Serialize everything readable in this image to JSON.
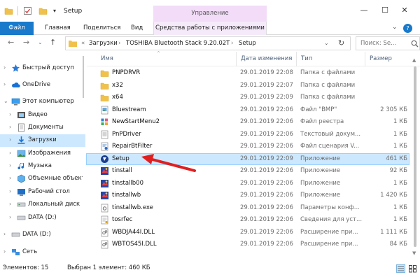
{
  "window": {
    "title": "Setup",
    "manage_tab": "Управление",
    "controls": {
      "minimize": "—",
      "maximize": "☐",
      "close": "✕"
    }
  },
  "ribbon": {
    "tabs": [
      "Файл",
      "Главная",
      "Поделиться",
      "Вид",
      "Средства работы с приложениями"
    ],
    "expand": "⌄",
    "help": "?"
  },
  "address": {
    "prefix": "«",
    "crumbs": [
      "Загрузки",
      "TOSHIBA Bluetooth Stack 9.20.02T",
      "Setup"
    ],
    "separator": "›",
    "search_placeholder": "Поиск: Se..."
  },
  "nav": {
    "back": "←",
    "forward": "→",
    "recent": "⌄",
    "up": "↑",
    "items": [
      {
        "label": "Быстрый доступ",
        "icon": "star-icon"
      },
      {
        "label": "OneDrive",
        "icon": "cloud-icon"
      },
      {
        "label": "Этот компьютер",
        "icon": "computer-icon"
      },
      {
        "label": "Видео",
        "icon": "video-icon"
      },
      {
        "label": "Документы",
        "icon": "documents-icon"
      },
      {
        "label": "Загрузки",
        "icon": "downloads-icon"
      },
      {
        "label": "Изображения",
        "icon": "pictures-icon"
      },
      {
        "label": "Музыка",
        "icon": "music-icon"
      },
      {
        "label": "Объемные объекты",
        "icon": "3d-objects-icon"
      },
      {
        "label": "Рабочий стол",
        "icon": "desktop-icon"
      },
      {
        "label": "Локальный диск",
        "icon": "drive-icon"
      },
      {
        "label": "DATA (D:)",
        "icon": "drive-icon"
      },
      {
        "label": "DATA (D:)",
        "icon": "drive-icon"
      },
      {
        "label": "Сеть",
        "icon": "network-icon"
      }
    ]
  },
  "columns": {
    "name": "Имя",
    "date": "Дата изменения",
    "type": "Тип",
    "size": "Размер"
  },
  "files": [
    {
      "name": "PNPDRVR",
      "date": "29.01.2019 22:08",
      "type": "Папка с файлами",
      "size": "",
      "icon": "folder-icon"
    },
    {
      "name": "x32",
      "date": "29.01.2019 22:07",
      "type": "Папка с файлами",
      "size": "",
      "icon": "folder-icon"
    },
    {
      "name": "x64",
      "date": "29.01.2019 22:09",
      "type": "Папка с файлами",
      "size": "",
      "icon": "folder-icon"
    },
    {
      "name": "Bluestream",
      "date": "29.01.2019 22:06",
      "type": "Файл \"BMP\"",
      "size": "2 305 КБ",
      "icon": "bmp-file-icon"
    },
    {
      "name": "NewStartMenu2",
      "date": "29.01.2019 22:06",
      "type": "Файл реестра",
      "size": "1 КБ",
      "icon": "registry-file-icon"
    },
    {
      "name": "PnPDriver",
      "date": "29.01.2019 22:06",
      "type": "Текстовый докум...",
      "size": "1 КБ",
      "icon": "text-file-icon"
    },
    {
      "name": "RepairBtFilter",
      "date": "29.01.2019 22:06",
      "type": "Файл сценария V...",
      "size": "1 КБ",
      "icon": "script-file-icon"
    },
    {
      "name": "Setup",
      "date": "29.01.2019 22:09",
      "type": "Приложение",
      "size": "461 КБ",
      "icon": "setup-app-icon",
      "selected": true
    },
    {
      "name": "tinstall",
      "date": "29.01.2019 22:06",
      "type": "Приложение",
      "size": "92 КБ",
      "icon": "app-icon"
    },
    {
      "name": "tinstallb00",
      "date": "29.01.2019 22:06",
      "type": "Приложение",
      "size": "1 КБ",
      "icon": "app-icon"
    },
    {
      "name": "tinstallwb",
      "date": "29.01.2019 22:06",
      "type": "Приложение",
      "size": "1 420 КБ",
      "icon": "app-icon"
    },
    {
      "name": "tinstallwb.exe",
      "date": "29.01.2019 22:06",
      "type": "Параметры конф...",
      "size": "1 КБ",
      "icon": "config-file-icon"
    },
    {
      "name": "tosrfec",
      "date": "29.01.2019 22:06",
      "type": "Сведения для уст...",
      "size": "1 КБ",
      "icon": "inf-file-icon"
    },
    {
      "name": "WBDJA44I.DLL",
      "date": "29.01.2019 22:06",
      "type": "Расширение при...",
      "size": "1 111 КБ",
      "icon": "dll-file-icon"
    },
    {
      "name": "WBTOS45I.DLL",
      "date": "29.01.2019 22:06",
      "type": "Расширение при...",
      "size": "84 КБ",
      "icon": "dll-file-icon"
    }
  ],
  "status": {
    "count": "Элементов: 15",
    "selection": "Выбран 1 элемент: 460 КБ"
  },
  "colors": {
    "accent": "#1979ca",
    "selection": "#cce8ff",
    "manage_tab": "#f2dcf8",
    "arrow": "#e02020"
  }
}
